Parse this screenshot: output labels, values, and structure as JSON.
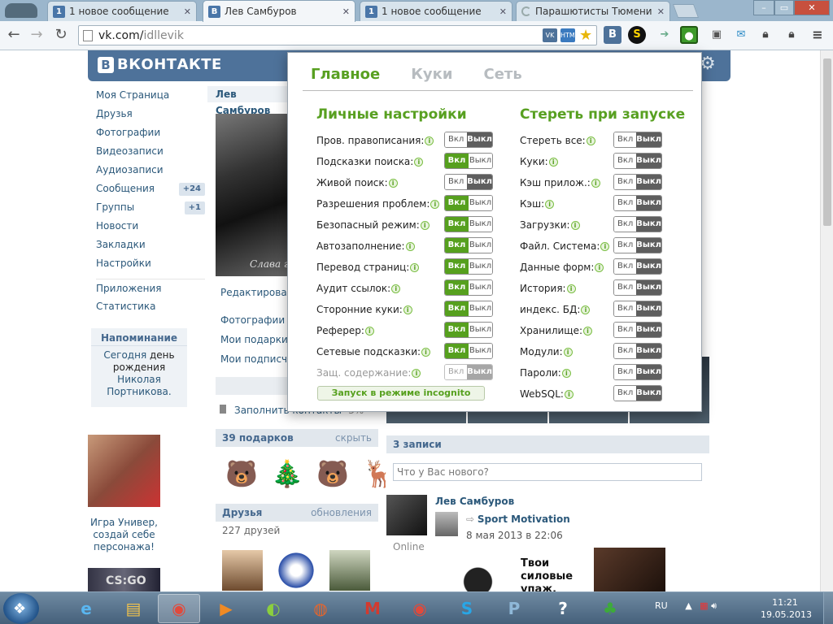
{
  "browser": {
    "tabs": [
      {
        "favicon": "1",
        "title": "1 новое сообщение",
        "active": false
      },
      {
        "favicon": "B",
        "title": "Лев Самбуров",
        "active": true
      },
      {
        "favicon": "1",
        "title": "1 новое сообщение",
        "active": false
      },
      {
        "favicon": "",
        "title": "Парашютисты Тюмени",
        "active": false
      }
    ],
    "url_host": "vk.com/",
    "url_path": "idllevik",
    "window_controls": {
      "minimize": "–",
      "maximize": "▭",
      "close": "✕"
    },
    "omnibox_icons": [
      "vk-icon",
      "html-validator-icon"
    ],
    "extension_icons": [
      "vk-logo-icon",
      "skype-icon",
      "forward-icon",
      "cookie-manager-icon",
      "cast-icon",
      "mail-icon",
      "lock-icon",
      "lock2-icon",
      "menu-icon"
    ]
  },
  "vk": {
    "logo": "ВКОНТАКТЕ",
    "logo_letter": "В",
    "nav": [
      {
        "label": "Моя Страница"
      },
      {
        "label": "Друзья"
      },
      {
        "label": "Фотографии"
      },
      {
        "label": "Видеозаписи"
      },
      {
        "label": "Аудиозаписи"
      },
      {
        "label": "Сообщения",
        "badge": "+24"
      },
      {
        "label": "Группы",
        "badge": "+1"
      },
      {
        "label": "Новости"
      },
      {
        "label": "Закладки"
      },
      {
        "label": "Настройки"
      },
      {
        "label": "Приложения"
      },
      {
        "label": "Статистика"
      }
    ],
    "reminder": {
      "title": "Напоминание",
      "text": "Сегодня",
      "bold": "день рождения",
      "name": "Николая Портникова."
    },
    "ad_text": "Игра Универ, создай себе персонажа!",
    "ad2_text": "CS:GO",
    "profile_name": "Лев Самбуров",
    "photo_caption": "Слава г",
    "edit_link": "Редактировать",
    "links": [
      "Фотографии со",
      "Мои подарки",
      "Мои подписчи"
    ],
    "fill_contacts": "Заполнить контакты",
    "fill_percent": "-3%",
    "gifts_title": "39 подарков",
    "gifts_hide": "скрыть",
    "gifts": [
      "🐻",
      "🎄",
      "🐻",
      "🦌"
    ],
    "friends_title": "Друзья",
    "friends_updates": "обновления",
    "friends_count": "227 друзей",
    "wall_title": "3 записи",
    "wall_placeholder": "Что у Вас нового?",
    "post_author": "Лев Самбуров",
    "post_source": "Sport Motivation",
    "post_date": "8 мая 2013 в 22:06",
    "online": "Online",
    "post_text": "Твои силовые упаж. ниже"
  },
  "popup": {
    "tabs": [
      "Главное",
      "Куки",
      "Сеть"
    ],
    "left_title": "Личные настройки",
    "right_title": "Стереть при запуске",
    "on_label": "Вкл",
    "off_label": "Выкл",
    "left": [
      {
        "label": "Пров. правописания:",
        "on": false
      },
      {
        "label": "Подсказки поиска:",
        "on": true
      },
      {
        "label": "Живой поиск:",
        "on": false
      },
      {
        "label": "Разрешения проблем:",
        "on": true
      },
      {
        "label": "Безопасный режим:",
        "on": true
      },
      {
        "label": "Автозаполнение:",
        "on": true
      },
      {
        "label": "Перевод страниц:",
        "on": true
      },
      {
        "label": "Аудит ссылок:",
        "on": true
      },
      {
        "label": "Сторонние куки:",
        "on": true
      },
      {
        "label": "Реферер:",
        "on": true
      },
      {
        "label": "Сетевые подсказки:",
        "on": true
      },
      {
        "label": "Защ. содержание:",
        "on": false,
        "disabled": true
      }
    ],
    "right": [
      {
        "label": "Стереть все:",
        "on": false
      },
      {
        "label": "Куки:",
        "on": false
      },
      {
        "label": "Кэш прилож.:",
        "on": false
      },
      {
        "label": "Кэш:",
        "on": false
      },
      {
        "label": "Загрузки:",
        "on": false
      },
      {
        "label": "Файл. Система:",
        "on": false
      },
      {
        "label": "Данные форм:",
        "on": false
      },
      {
        "label": "История:",
        "on": false
      },
      {
        "label": "индекс. БД:",
        "on": false
      },
      {
        "label": "Хранилище:",
        "on": false
      },
      {
        "label": "Модули:",
        "on": false
      },
      {
        "label": "Пароли:",
        "on": false
      },
      {
        "label": "WebSQL:",
        "on": false
      }
    ],
    "incognito": "Запуск в режиме incognito"
  },
  "taskbar": {
    "apps": [
      "ie-icon",
      "explorer-icon",
      "chrome-icon",
      "media-player-icon",
      "mixer-icon",
      "firefox-icon",
      "gmail-icon",
      "chrome2-icon",
      "skype-icon",
      "p-app-icon",
      "help-icon",
      "tree-app-icon"
    ],
    "lang": "RU",
    "time": "11:21",
    "date": "19.05.2013"
  },
  "colors": {
    "vk_blue": "#4e729a",
    "green": "#58a021",
    "toggle_off": "#5e5e5e"
  }
}
